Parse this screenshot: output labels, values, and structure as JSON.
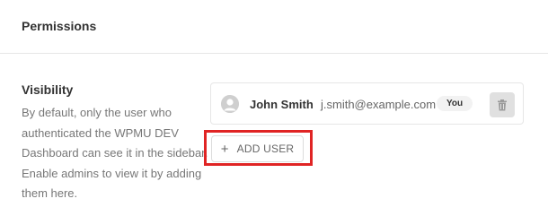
{
  "panel": {
    "title": "Permissions"
  },
  "visibility": {
    "title": "Visibility",
    "description": "By default, only the user who authenticated the WPMU DEV Dashboard can see it in the sidebar. Enable admins to view it by adding them here."
  },
  "user": {
    "name": "John Smith",
    "email": "j.smith@example.com",
    "badge": "You"
  },
  "add_user": {
    "label": "ADD USER",
    "icon": "plus-icon"
  },
  "colors": {
    "highlight": "#e02424"
  }
}
